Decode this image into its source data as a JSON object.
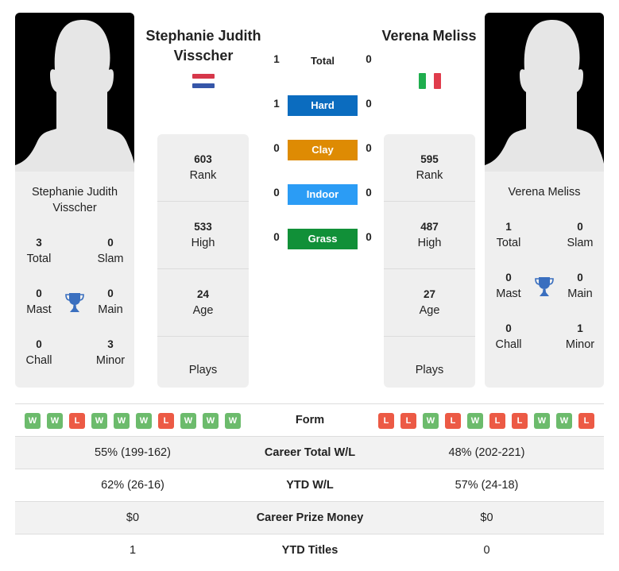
{
  "colors": {
    "hard": "#0b6cbf",
    "clay": "#de8b03",
    "indoor": "#2b9cf5",
    "grass": "#119038",
    "win": "#6cbb6c",
    "loss": "#ec5a45",
    "trophy": "#3a6fbf"
  },
  "player1": {
    "name_heading": "Stephanie Judith Visscher",
    "card_name": "Stephanie Judith Visscher",
    "flag": "netherlands-flag",
    "titles": {
      "total": {
        "value": "3",
        "label": "Total"
      },
      "slam": {
        "value": "0",
        "label": "Slam"
      },
      "mast": {
        "value": "0",
        "label": "Mast"
      },
      "main": {
        "value": "0",
        "label": "Main"
      },
      "chall": {
        "value": "0",
        "label": "Chall"
      },
      "minor": {
        "value": "3",
        "label": "Minor"
      }
    },
    "rank": {
      "value": "603",
      "label": "Rank"
    },
    "high": {
      "value": "533",
      "label": "High"
    },
    "age": {
      "value": "24",
      "label": "Age"
    },
    "plays": {
      "value": "",
      "label": "Plays"
    },
    "form": [
      "W",
      "W",
      "L",
      "W",
      "W",
      "W",
      "L",
      "W",
      "W",
      "W"
    ],
    "career_wl": "55% (199-162)",
    "ytd_wl": "62% (26-16)",
    "prize_money": "$0",
    "ytd_titles": "1"
  },
  "player2": {
    "name_heading": "Verena Meliss",
    "card_name": "Verena Meliss",
    "flag": "italy-flag",
    "titles": {
      "total": {
        "value": "1",
        "label": "Total"
      },
      "slam": {
        "value": "0",
        "label": "Slam"
      },
      "mast": {
        "value": "0",
        "label": "Mast"
      },
      "main": {
        "value": "0",
        "label": "Main"
      },
      "chall": {
        "value": "0",
        "label": "Chall"
      },
      "minor": {
        "value": "1",
        "label": "Minor"
      }
    },
    "rank": {
      "value": "595",
      "label": "Rank"
    },
    "high": {
      "value": "487",
      "label": "High"
    },
    "age": {
      "value": "27",
      "label": "Age"
    },
    "plays": {
      "value": "",
      "label": "Plays"
    },
    "form": [
      "L",
      "L",
      "W",
      "L",
      "W",
      "L",
      "L",
      "W",
      "W",
      "L"
    ],
    "career_wl": "48% (202-221)",
    "ytd_wl": "57% (24-18)",
    "prize_money": "$0",
    "ytd_titles": "0"
  },
  "h2h": {
    "total": {
      "label": "Total",
      "p1": "1",
      "p2": "0"
    },
    "hard": {
      "label": "Hard",
      "p1": "1",
      "p2": "0"
    },
    "clay": {
      "label": "Clay",
      "p1": "0",
      "p2": "0"
    },
    "indoor": {
      "label": "Indoor",
      "p1": "0",
      "p2": "0"
    },
    "grass": {
      "label": "Grass",
      "p1": "0",
      "p2": "0"
    }
  },
  "table_labels": {
    "form": "Form",
    "career_wl": "Career Total W/L",
    "ytd_wl": "YTD W/L",
    "prize_money": "Career Prize Money",
    "ytd_titles": "YTD Titles"
  }
}
